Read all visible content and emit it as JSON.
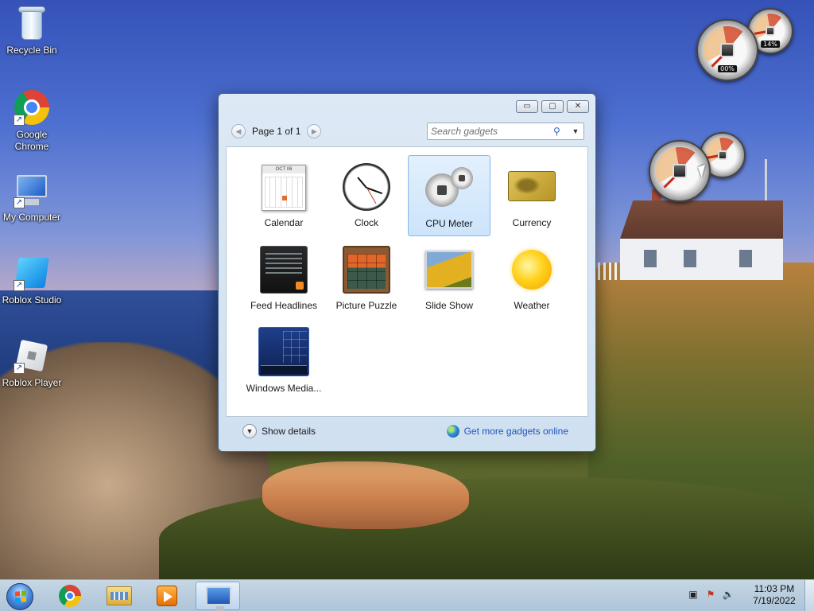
{
  "desktop": {
    "icons": [
      {
        "label": "Recycle Bin",
        "icon": "recycle-bin-icon"
      },
      {
        "label": "Google\nChrome",
        "icon": "chrome-icon"
      },
      {
        "label": "My Computer",
        "icon": "computer-icon"
      },
      {
        "label": "Roblox Studio",
        "icon": "roblox-studio-icon"
      },
      {
        "label": "Roblox Player",
        "icon": "roblox-player-icon"
      }
    ],
    "gadgets": [
      {
        "type": "cpu-meter",
        "cpu_reading": "00%",
        "memory_reading": "14%"
      },
      {
        "type": "cpu-meter",
        "cpu_reading": "",
        "memory_reading": ""
      }
    ]
  },
  "gallery": {
    "window_controls": {
      "minimize": "▭",
      "restore": "▢",
      "close": "✕"
    },
    "pager": {
      "prev": "◀",
      "text": "Page 1 of 1",
      "next": "▶"
    },
    "search": {
      "placeholder": "Search gadgets",
      "value": ""
    },
    "gadgets": [
      {
        "label": "Calendar",
        "calendar_header": "OCT 06",
        "selected": false
      },
      {
        "label": "Clock",
        "selected": false
      },
      {
        "label": "CPU Meter",
        "selected": true
      },
      {
        "label": "Currency",
        "selected": false
      },
      {
        "label": "Feed Headlines",
        "selected": false
      },
      {
        "label": "Picture Puzzle",
        "selected": false
      },
      {
        "label": "Slide Show",
        "selected": false
      },
      {
        "label": "Weather",
        "selected": false
      },
      {
        "label": "Windows Media...",
        "selected": false
      }
    ],
    "show_details": "Show details",
    "get_more": "Get more gadgets online"
  },
  "taskbar": {
    "apps": [
      "chrome-icon",
      "file-explorer-icon",
      "media-player-icon",
      "desktop-gadgets-icon"
    ],
    "active_app": "desktop-gadgets-icon",
    "tray_icons": [
      "network-icon",
      "action-center-icon",
      "volume-icon"
    ],
    "time": "11:03 PM",
    "date": "7/19/2022"
  },
  "colors": {
    "selection_bg": "#cce4fb",
    "link": "#1f55b7",
    "taskbar": "#b2cae2"
  }
}
